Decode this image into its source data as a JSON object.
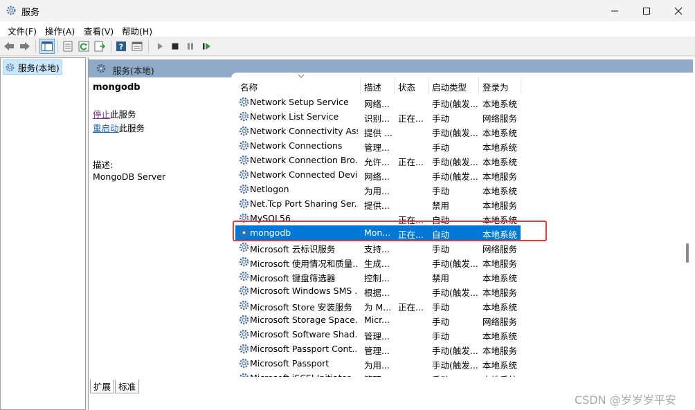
{
  "window": {
    "title": "服务"
  },
  "menu": [
    "文件(F)",
    "操作(A)",
    "查看(V)",
    "帮助(H)"
  ],
  "toolbar_icons": [
    "back-icon",
    "forward-icon",
    "show-hide-tree-icon",
    "properties-icon",
    "refresh-icon",
    "export-list-icon",
    "help-icon",
    "view-icon",
    "start-icon",
    "stop-icon",
    "pause-icon",
    "restart-icon"
  ],
  "tree": {
    "root_label": "服务(本地)"
  },
  "panel": {
    "title": "服务(本地)"
  },
  "detail": {
    "service_name": "mongodb",
    "stop_link": "停止",
    "stop_suffix": "此服务",
    "restart_link": "重启动",
    "restart_suffix": "此服务",
    "desc_label": "描述:",
    "desc_text": "MongoDB Server"
  },
  "columns": {
    "name": "名称",
    "desc": "描述",
    "status": "状态",
    "startup": "启动类型",
    "logon": "登录为"
  },
  "services": [
    {
      "name": "Network Setup Service",
      "desc": "网络...",
      "status": "",
      "startup": "手动(触发...",
      "logon": "本地系统"
    },
    {
      "name": "Network List Service",
      "desc": "识别...",
      "status": "正在...",
      "startup": "手动",
      "logon": "网络服务"
    },
    {
      "name": "Network Connectivity Ass...",
      "desc": "提供 ...",
      "status": "",
      "startup": "手动(触发...",
      "logon": "本地系统"
    },
    {
      "name": "Network Connections",
      "desc": "管理...",
      "status": "",
      "startup": "手动",
      "logon": "本地系统"
    },
    {
      "name": "Network Connection Bro...",
      "desc": "允许...",
      "status": "正在...",
      "startup": "手动(触发...",
      "logon": "本地系统"
    },
    {
      "name": "Network Connected Devi...",
      "desc": "网络...",
      "status": "",
      "startup": "手动(触发...",
      "logon": "本地服务"
    },
    {
      "name": "Netlogon",
      "desc": "为用...",
      "status": "",
      "startup": "手动",
      "logon": "本地系统"
    },
    {
      "name": "Net.Tcp Port Sharing Ser...",
      "desc": "提供...",
      "status": "",
      "startup": "禁用",
      "logon": "本地服务"
    },
    {
      "name": "MySQL56",
      "desc": "",
      "status": "正在...",
      "startup": "自动",
      "logon": "本地系统"
    },
    {
      "name": "mongodb",
      "desc": "Mon...",
      "status": "正在...",
      "startup": "自动",
      "logon": "本地系统"
    },
    {
      "name": "Microsoft 云标识服务",
      "desc": "支持...",
      "status": "",
      "startup": "手动",
      "logon": "网络服务"
    },
    {
      "name": "Microsoft 使用情况和质量...",
      "desc": "生成...",
      "status": "",
      "startup": "手动(触发...",
      "logon": "本地服务"
    },
    {
      "name": "Microsoft 键盘筛选器",
      "desc": "控制...",
      "status": "",
      "startup": "禁用",
      "logon": "本地系统"
    },
    {
      "name": "Microsoft Windows SMS ...",
      "desc": "根据...",
      "status": "",
      "startup": "手动(触发...",
      "logon": "本地服务"
    },
    {
      "name": "Microsoft Store 安装服务",
      "desc": "为 M...",
      "status": "正在...",
      "startup": "手动",
      "logon": "本地系统"
    },
    {
      "name": "Microsoft Storage Space...",
      "desc": "Micr...",
      "status": "",
      "startup": "手动",
      "logon": "网络服务"
    },
    {
      "name": "Microsoft Software Shad...",
      "desc": "管理...",
      "status": "",
      "startup": "手动",
      "logon": "本地系统"
    },
    {
      "name": "Microsoft Passport Cont...",
      "desc": "管理...",
      "status": "",
      "startup": "手动(触发...",
      "logon": "本地服务"
    },
    {
      "name": "Microsoft Passport",
      "desc": "为用...",
      "status": "",
      "startup": "手动(触发...",
      "logon": "本地系统"
    },
    {
      "name": "Microsoft iSCSI Initiator ...",
      "desc": "管理...",
      "status": "",
      "startup": "手动",
      "logon": "本地系统"
    }
  ],
  "tabs": [
    "扩展",
    "标准"
  ],
  "watermark": "CSDN @岁岁岁平安"
}
